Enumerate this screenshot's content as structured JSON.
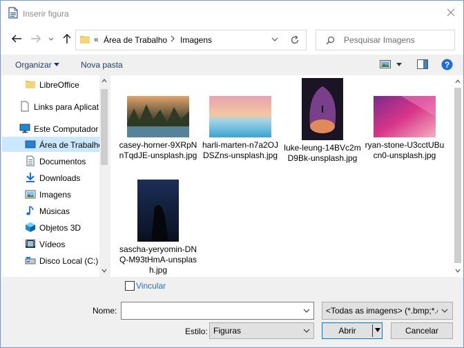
{
  "window": {
    "title": "Inserir figura"
  },
  "address": {
    "overflow": "«",
    "crumbs": [
      "Área de Trabalho",
      "Imagens"
    ]
  },
  "search": {
    "placeholder": "Pesquisar Imagens"
  },
  "toolbar": {
    "organize_label": "Organizar",
    "new_folder_label": "Nova pasta"
  },
  "sidebar": {
    "items": [
      {
        "label": "LibreOffice",
        "icon": "folder-icon"
      },
      {
        "label": "Links para Aplicat",
        "icon": "document-icon"
      },
      {
        "label": "Este Computador",
        "icon": "computer-icon"
      },
      {
        "label": "Área de Trabalho",
        "icon": "desktop-icon",
        "selected": true
      },
      {
        "label": "Documentos",
        "icon": "documents-icon"
      },
      {
        "label": "Downloads",
        "icon": "downloads-icon"
      },
      {
        "label": "Imagens",
        "icon": "pictures-icon"
      },
      {
        "label": "Músicas",
        "icon": "music-icon"
      },
      {
        "label": "Objetos 3D",
        "icon": "objects-3d-icon"
      },
      {
        "label": "Vídeos",
        "icon": "videos-icon"
      },
      {
        "label": "Disco Local (C:)",
        "icon": "drive-icon"
      }
    ]
  },
  "files": [
    {
      "name": "casey-horner-9XRpNnTqdJE-unsplash.jpg"
    },
    {
      "name": "harli-marten-n7a2OJDSZns-unsplash.jpg"
    },
    {
      "name": "luke-leung-14BVc2mD9Bk-unsplash.jpg"
    },
    {
      "name": "ryan-stone-U3cctUBucn0-unsplash.jpg"
    },
    {
      "name": "sascha-yeryomin-DNQ-M93tHmA-unsplash.jpg"
    }
  ],
  "options": {
    "link_label": "Vincular"
  },
  "footer": {
    "name_label": "Nome:",
    "name_value": "",
    "filetype_value": "<Todas as imagens> (*.bmp;*.c",
    "style_label": "Estilo:",
    "style_value": "Figuras",
    "open_label": "Abrir",
    "cancel_label": "Cancelar"
  },
  "colors": {
    "accent": "#0078d7",
    "selection": "#cce8ff",
    "link": "#2a6ebb"
  }
}
